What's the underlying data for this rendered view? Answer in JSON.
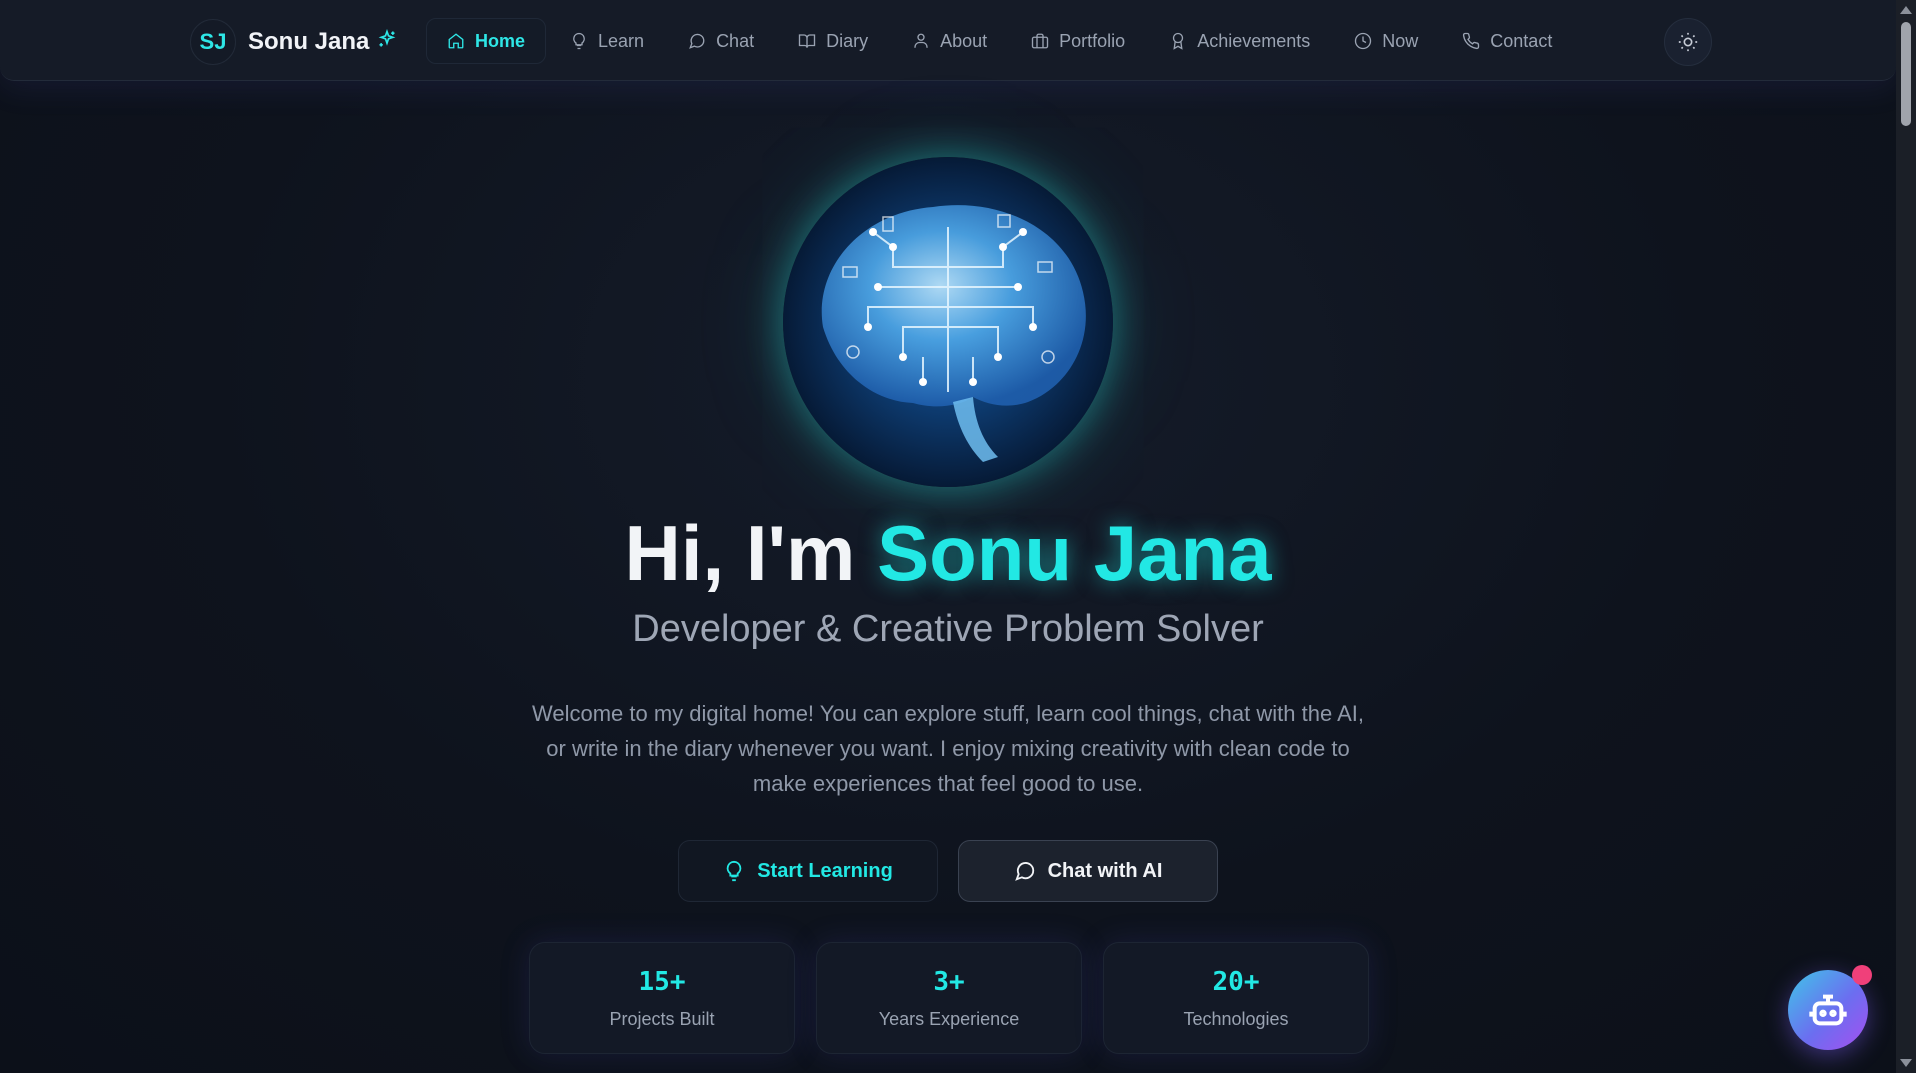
{
  "brand": {
    "initials": "SJ",
    "name": "Sonu Jana",
    "spark_icon": "sparkles-icon"
  },
  "nav": {
    "items": [
      {
        "label": "Home",
        "icon": "home-icon",
        "active": true
      },
      {
        "label": "Learn",
        "icon": "lightbulb-icon"
      },
      {
        "label": "Chat",
        "icon": "message-circle-icon"
      },
      {
        "label": "Diary",
        "icon": "book-open-icon"
      },
      {
        "label": "About",
        "icon": "user-icon"
      },
      {
        "label": "Portfolio",
        "icon": "briefcase-icon"
      },
      {
        "label": "Achievements",
        "icon": "award-icon"
      },
      {
        "label": "Now",
        "icon": "clock-icon"
      },
      {
        "label": "Contact",
        "icon": "phone-icon"
      }
    ],
    "theme_toggle_icon": "sun-icon"
  },
  "hero": {
    "image": "brain-circuit-image",
    "title_prefix": "Hi, I'm ",
    "title_name": "Sonu Jana",
    "subtitle": "Developer & Creative Problem Solver",
    "description": "Welcome to my digital home! You can explore stuff, learn cool things, chat with the AI, or write in the diary whenever you want. I enjoy mixing creativity with clean code to make experiences that feel good to use."
  },
  "actions": {
    "learn_label": "Start Learning",
    "chat_label": "Chat with AI"
  },
  "stats": [
    {
      "value": "15+",
      "label": "Projects Built"
    },
    {
      "value": "3+",
      "label": "Years Experience"
    },
    {
      "value": "20+",
      "label": "Technologies"
    }
  ],
  "chatbot_fab": {
    "icon": "bot-icon",
    "notification": true
  },
  "colors": {
    "accent": "#22e8e4",
    "background": "#0e131d",
    "fab_dot": "#f0407a"
  }
}
